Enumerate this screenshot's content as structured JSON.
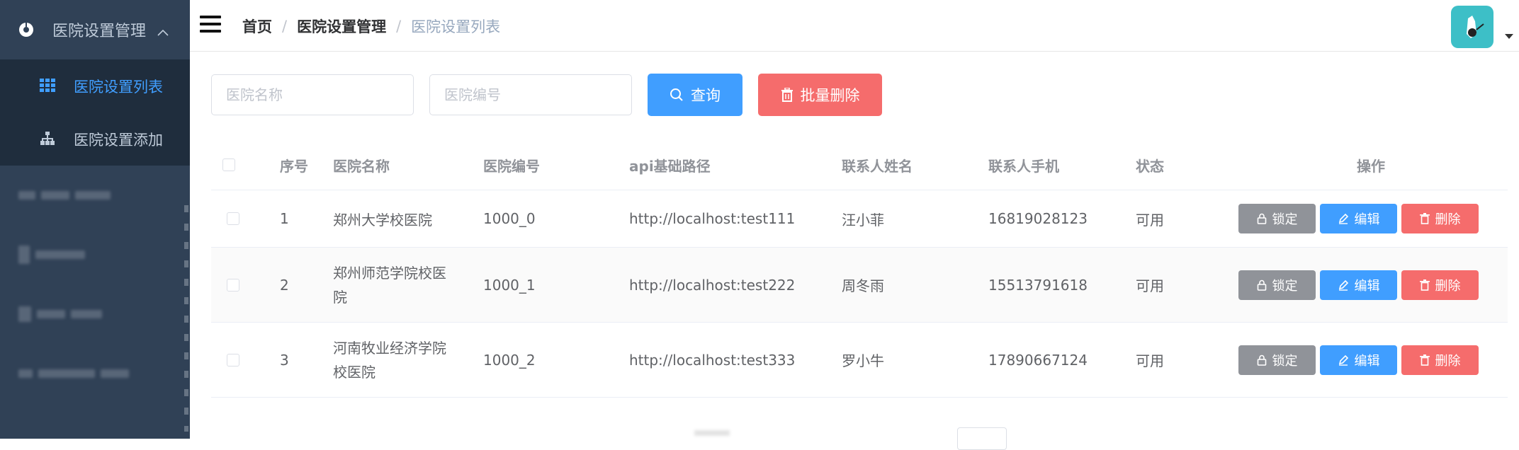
{
  "sidebar": {
    "menu_title": "医院设置管理",
    "items": [
      {
        "label": "医院设置列表",
        "icon": "grid-icon",
        "active": true
      },
      {
        "label": "医院设置添加",
        "icon": "tree-icon",
        "active": false
      }
    ]
  },
  "navbar": {
    "breadcrumb": [
      "首页",
      "医院设置管理",
      "医院设置列表"
    ]
  },
  "filters": {
    "hosname_placeholder": "医院名称",
    "hoscode_placeholder": "医院编号",
    "query_label": "查询",
    "batch_delete_label": "批量删除"
  },
  "table": {
    "headers": [
      "序号",
      "医院名称",
      "医院编号",
      "api基础路径",
      "联系人姓名",
      "联系人手机",
      "状态",
      "操作"
    ],
    "rows": [
      {
        "index": "1",
        "name_line1": "郑州大学校医院",
        "name_line2": "",
        "code": "1000_0",
        "api": "http://localhost:test111",
        "contact": "汪小菲",
        "phone": "16819028123",
        "status": "可用"
      },
      {
        "index": "2",
        "name_line1": "郑州师范学院校医",
        "name_line2": "院",
        "code": "1000_1",
        "api": "http://localhost:test222",
        "contact": "周冬雨",
        "phone": "15513791618",
        "status": "可用"
      },
      {
        "index": "3",
        "name_line1": "河南牧业经济学院",
        "name_line2": "校医院",
        "code": "1000_2",
        "api": "http://localhost:test333",
        "contact": "罗小牛",
        "phone": "17890667124",
        "status": "可用"
      }
    ],
    "actions": {
      "lock": "锁定",
      "edit": "编辑",
      "delete": "删除"
    }
  },
  "colors": {
    "sidebar_bg": "#304156",
    "submenu_bg": "#1f2d3d",
    "primary": "#409eff",
    "danger": "#f56c6c",
    "info": "#909399"
  }
}
